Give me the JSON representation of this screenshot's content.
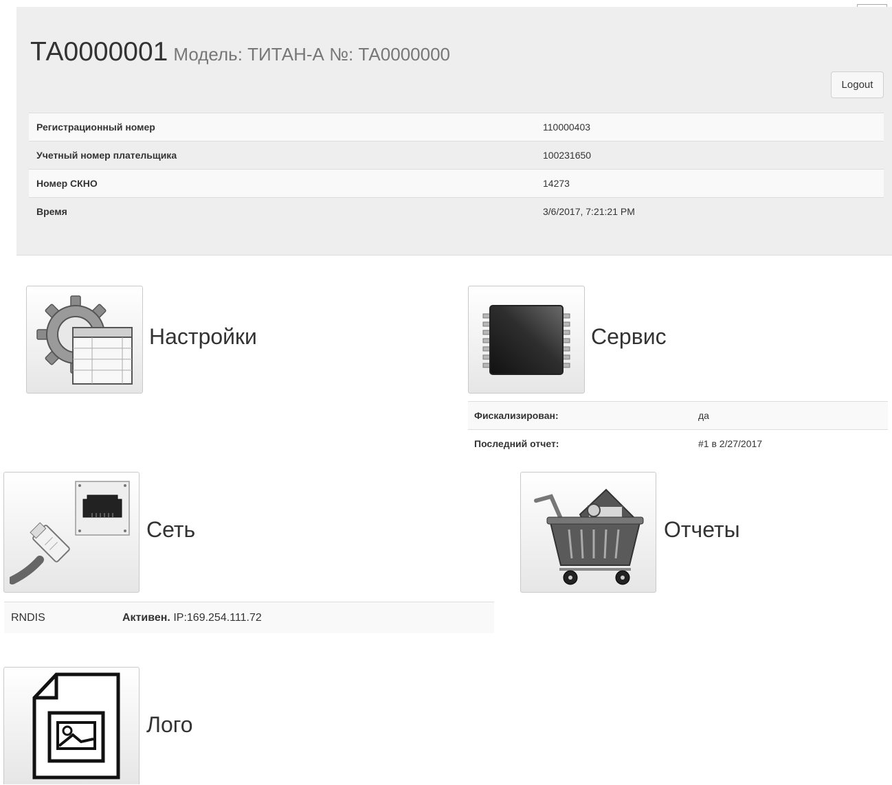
{
  "language": {
    "selected": "ru"
  },
  "header": {
    "serial": "ТА0000001",
    "model": "Модель: ТИТАН-А №: ТА0000000",
    "logout_label": "Logout"
  },
  "info": [
    {
      "label": "Регистрационный номер",
      "value": "110000403"
    },
    {
      "label": "Учетный номер плательщика",
      "value": "100231650"
    },
    {
      "label": "Номер СКНО",
      "value": "14273"
    },
    {
      "label": "Время",
      "value": "3/6/2017, 7:21:21 PM"
    }
  ],
  "tiles": {
    "settings": {
      "label": "Настройки",
      "icon": "settings-gear-table-icon"
    },
    "service": {
      "label": "Сервис",
      "icon": "chip-icon",
      "rows": [
        {
          "label": "Фискализирован:",
          "value": "да"
        },
        {
          "label": "Последний отчет:",
          "value": "#1 в 2/27/2017"
        }
      ]
    },
    "network": {
      "label": "Сеть",
      "icon": "ethernet-cable-icon",
      "interface": "RNDIS",
      "status": "Активен.",
      "ip": "IP:169.254.111.72"
    },
    "reports": {
      "label": "Отчеты",
      "icon": "shopping-cart-icon"
    },
    "logo": {
      "label": "Лого",
      "icon": "image-file-icon"
    }
  }
}
